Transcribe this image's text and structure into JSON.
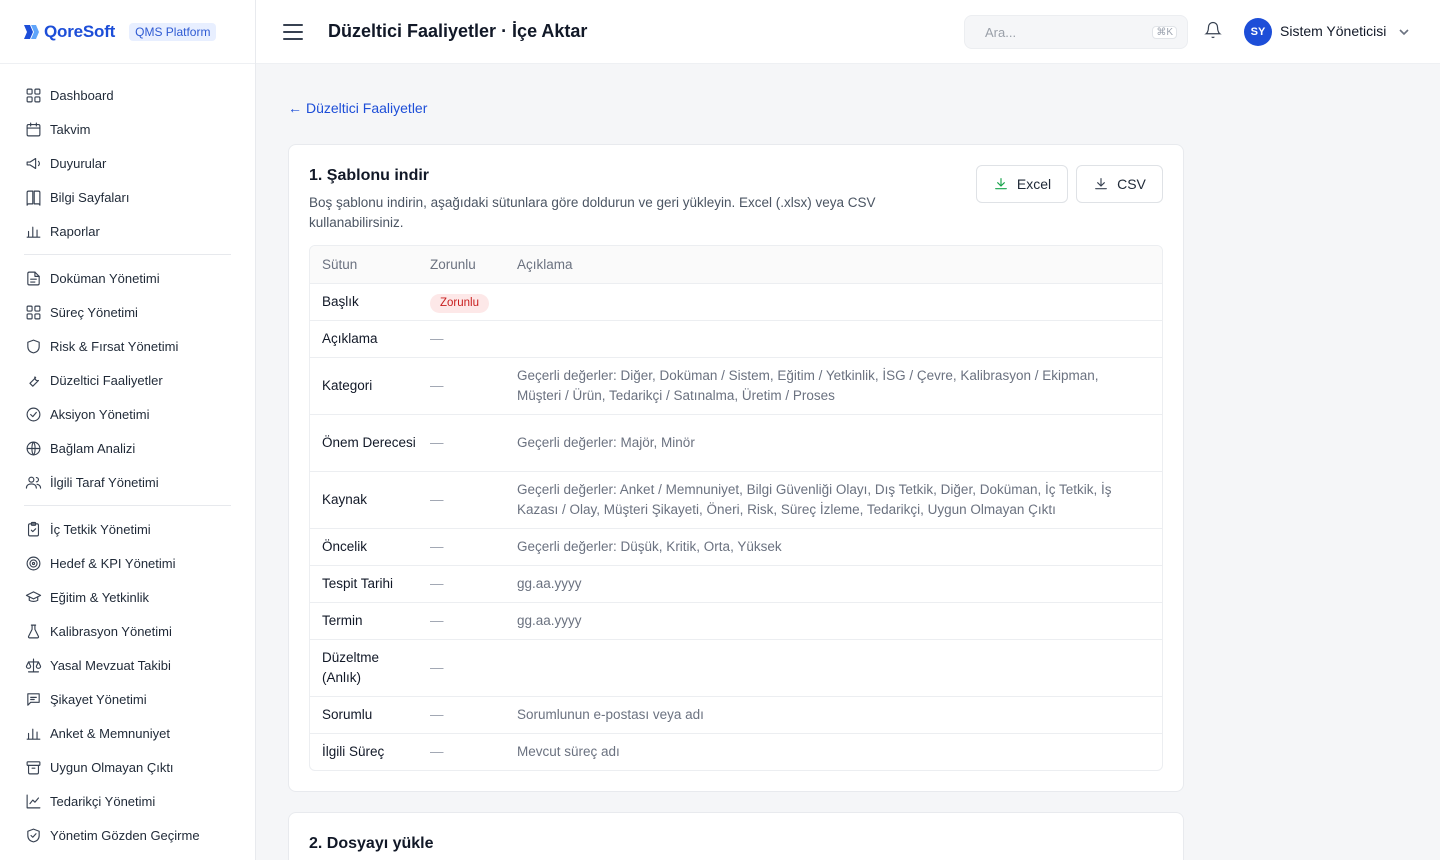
{
  "brand": {
    "name": "QoreSoft",
    "badge": "QMS Platform"
  },
  "sidebar": {
    "groups": [
      [
        {
          "label": "Dashboard",
          "icon": "grid-icon"
        },
        {
          "label": "Takvim",
          "icon": "calendar-icon"
        },
        {
          "label": "Duyurular",
          "icon": "megaphone-icon"
        },
        {
          "label": "Bilgi Sayfaları",
          "icon": "book-icon"
        },
        {
          "label": "Raporlar",
          "icon": "bar-chart-icon"
        }
      ],
      [
        {
          "label": "Doküman Yönetimi",
          "icon": "file-icon"
        },
        {
          "label": "Süreç Yönetimi",
          "icon": "grid-icon"
        },
        {
          "label": "Risk & Fırsat Yönetimi",
          "icon": "shield-icon"
        },
        {
          "label": "Düzeltici Faaliyetler",
          "icon": "wrench-icon"
        },
        {
          "label": "Aksiyon Yönetimi",
          "icon": "check-circle-icon"
        },
        {
          "label": "Bağlam Analizi",
          "icon": "globe-icon"
        },
        {
          "label": "İlgili Taraf Yönetimi",
          "icon": "users-icon"
        }
      ],
      [
        {
          "label": "İç Tetkik Yönetimi",
          "icon": "clipboard-icon"
        },
        {
          "label": "Hedef & KPI Yönetimi",
          "icon": "target-icon"
        },
        {
          "label": "Eğitim & Yetkinlik",
          "icon": "graduation-cap-icon"
        },
        {
          "label": "Kalibrasyon Yönetimi",
          "icon": "flask-icon"
        },
        {
          "label": "Yasal Mevzuat Takibi",
          "icon": "scale-icon"
        },
        {
          "label": "Şikayet Yönetimi",
          "icon": "message-icon"
        },
        {
          "label": "Anket & Memnuniyet",
          "icon": "bar-chart-icon"
        },
        {
          "label": "Uygun Olmayan Çıktı",
          "icon": "archive-icon"
        },
        {
          "label": "Tedarikçi Yönetimi",
          "icon": "line-chart-icon"
        },
        {
          "label": "Yönetim Gözden Geçirme",
          "icon": "shield-check-icon"
        }
      ]
    ]
  },
  "header": {
    "title": "Düzeltici Faaliyetler · İçe Aktar",
    "search_placeholder": "Ara...",
    "search_shortcut": "⌘K",
    "user_initials": "SY",
    "user_name": "Sistem Yöneticisi"
  },
  "main": {
    "back_link": "Düzeltici Faaliyetler",
    "step1": {
      "title": "1. Şablonu indir",
      "description": "Boş şablonu indirin, aşağıdaki sütunlara göre doldurun ve geri yükleyin. Excel (.xlsx) veya CSV kullanabilirsiniz.",
      "excel_label": "Excel",
      "csv_label": "CSV",
      "table": {
        "headers": [
          "Sütun",
          "Zorunlu",
          "Açıklama"
        ],
        "rows": [
          {
            "column": "Başlık",
            "required": "Zorunlu",
            "description": ""
          },
          {
            "column": "Açıklama",
            "required": "—",
            "description": ""
          },
          {
            "column": "Kategori",
            "required": "—",
            "description": "Geçerli değerler: Diğer, Doküman / Sistem, Eğitim / Yetkinlik, İSG / Çevre, Kalibrasyon / Ekipman, Müşteri / Ürün, Tedarikçi / Satınalma, Üretim / Proses"
          },
          {
            "column": "Önem Derecesi",
            "required": "—",
            "description": "Geçerli değerler: Majör, Minör"
          },
          {
            "column": "Kaynak",
            "required": "—",
            "description": "Geçerli değerler: Anket / Memnuniyet, Bilgi Güvenliği Olayı, Dış Tetkik, Diğer, Doküman, İç Tetkik, İş Kazası / Olay, Müşteri Şikayeti, Öneri, Risk, Süreç İzleme, Tedarikçi, Uygun Olmayan Çıktı"
          },
          {
            "column": "Öncelik",
            "required": "—",
            "description": "Geçerli değerler: Düşük, Kritik, Orta, Yüksek"
          },
          {
            "column": "Tespit Tarihi",
            "required": "—",
            "description": "gg.aa.yyyy"
          },
          {
            "column": "Termin",
            "required": "—",
            "description": "gg.aa.yyyy"
          },
          {
            "column": "Düzeltme (Anlık)",
            "required": "—",
            "description": ""
          },
          {
            "column": "Sorumlu",
            "required": "—",
            "description": "Sorumlunun e-postası veya adı"
          },
          {
            "column": "İlgili Süreç",
            "required": "—",
            "description": "Mevcut süreç adı"
          }
        ]
      }
    },
    "step2": {
      "title": "2. Dosyayı yükle"
    }
  }
}
